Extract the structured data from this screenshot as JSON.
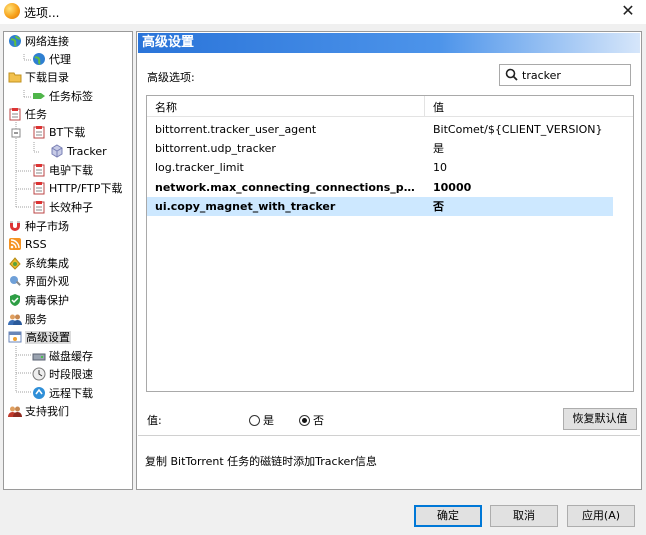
{
  "window": {
    "title": "选项..."
  },
  "sidebar": {
    "items": [
      {
        "label": "网络连接",
        "icon": "globe-icon"
      },
      {
        "label": "代理",
        "icon": "globe-small-icon"
      },
      {
        "label": "下载目录",
        "icon": "folder-icon"
      },
      {
        "label": "任务标签",
        "icon": "tag-icon"
      },
      {
        "label": "任务",
        "icon": "task-clipboard-icon"
      },
      {
        "label": "BT下载",
        "icon": "bt-clipboard-icon"
      },
      {
        "label": "Tracker",
        "icon": "cube-icon"
      },
      {
        "label": "电驴下载",
        "icon": "ed2k-clipboard-icon"
      },
      {
        "label": "HTTP/FTP下载",
        "icon": "http-clipboard-icon"
      },
      {
        "label": "长效种子",
        "icon": "seed-clipboard-icon"
      },
      {
        "label": "种子市场",
        "icon": "magnet-icon"
      },
      {
        "label": "RSS",
        "icon": "rss-icon"
      },
      {
        "label": "系统集成",
        "icon": "puzzle-icon"
      },
      {
        "label": "界面外观",
        "icon": "paint-icon"
      },
      {
        "label": "病毒保护",
        "icon": "shield-icon"
      },
      {
        "label": "服务",
        "icon": "users-icon"
      },
      {
        "label": "高级设置",
        "icon": "advanced-settings-icon"
      },
      {
        "label": "磁盘缓存",
        "icon": "disk-icon"
      },
      {
        "label": "时段限速",
        "icon": "clock-icon"
      },
      {
        "label": "远程下载",
        "icon": "remote-icon"
      },
      {
        "label": "支持我们",
        "icon": "support-icon"
      }
    ]
  },
  "panel": {
    "title": "高级设置",
    "options_label": "高级选项:",
    "search": {
      "value": "tracker",
      "icon": "search-icon"
    },
    "table": {
      "columns": [
        "名称",
        "值"
      ],
      "rows": [
        {
          "name": "bittorrent.tracker_user_agent",
          "value": "BitComet/${CLIENT_VERSION}"
        },
        {
          "name": "bittorrent.udp_tracker",
          "value": "是"
        },
        {
          "name": "log.tracker_limit",
          "value": "10"
        },
        {
          "name": "network.max_connecting_connections_per_tra...",
          "value": "10000"
        },
        {
          "name": "ui.copy_magnet_with_tracker",
          "value": "否"
        }
      ]
    },
    "value_label": "值:",
    "radio_yes": "是",
    "radio_no": "否",
    "selected_radio": "否",
    "restore_default": "恢复默认值",
    "description": "复制 BitTorrent 任务的磁链时添加Tracker信息"
  },
  "buttons": {
    "ok": "确定",
    "cancel": "取消",
    "apply": "应用(A)"
  },
  "colors": {
    "header_start": "#2a74d9",
    "header_end": "#d6e6fa",
    "row_selected": "#cde8ff",
    "default_button_border": "#0078d7"
  }
}
